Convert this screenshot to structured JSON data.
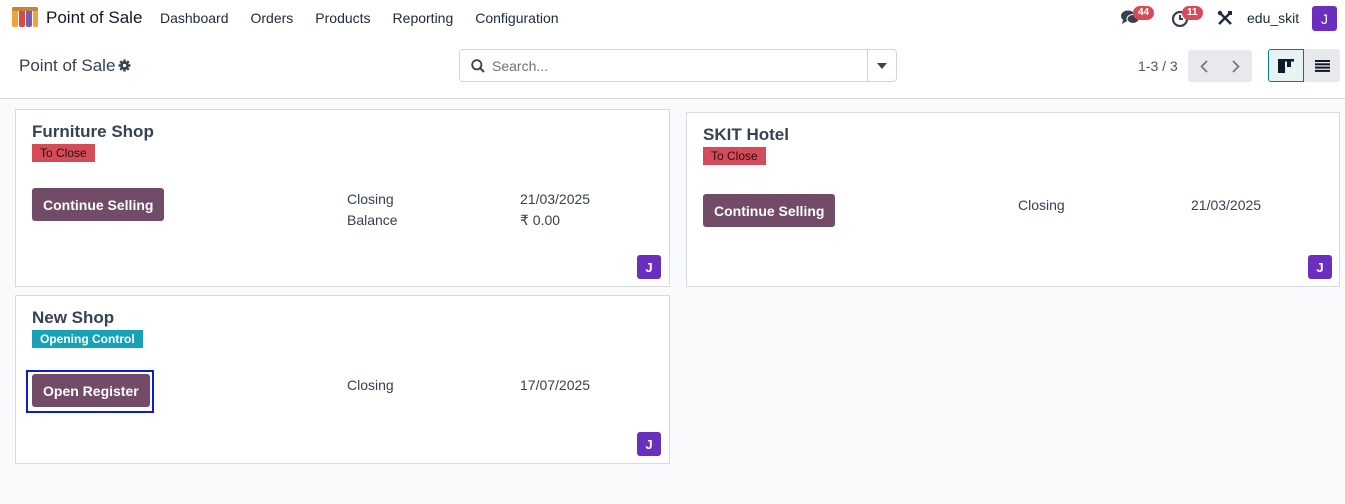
{
  "navbar": {
    "app_name": "Point of Sale",
    "menu": [
      "Dashboard",
      "Orders",
      "Products",
      "Reporting",
      "Configuration"
    ],
    "messages_count": "44",
    "activities_count": "11",
    "user_name": "edu_skit",
    "user_initial": "J"
  },
  "control_panel": {
    "title": "Point of Sale",
    "search_placeholder": "Search...",
    "pager": "1-3 / 3"
  },
  "cards": [
    {
      "name": "Furniture Shop",
      "status": "To Close",
      "button": "Continue Selling",
      "closing_label": "Closing",
      "closing_date": "21/03/2025",
      "balance_label": "Balance",
      "balance_value": "₹ 0.00",
      "user_initial": "J"
    },
    {
      "name": "SKIT Hotel",
      "status": "To Close",
      "button": "Continue Selling",
      "closing_label": "Closing",
      "closing_date": "21/03/2025",
      "user_initial": "J"
    },
    {
      "name": "New Shop",
      "status": "Opening Control",
      "button": "Open Register",
      "closing_label": "Closing",
      "closing_date": "17/07/2025",
      "user_initial": "J"
    }
  ],
  "colors": {
    "primary": "#714b67",
    "danger_tag": "#d44c59",
    "info_tag": "#17a2b8",
    "avatar": "#6b2fbf",
    "focus": "#0a1ecc"
  }
}
